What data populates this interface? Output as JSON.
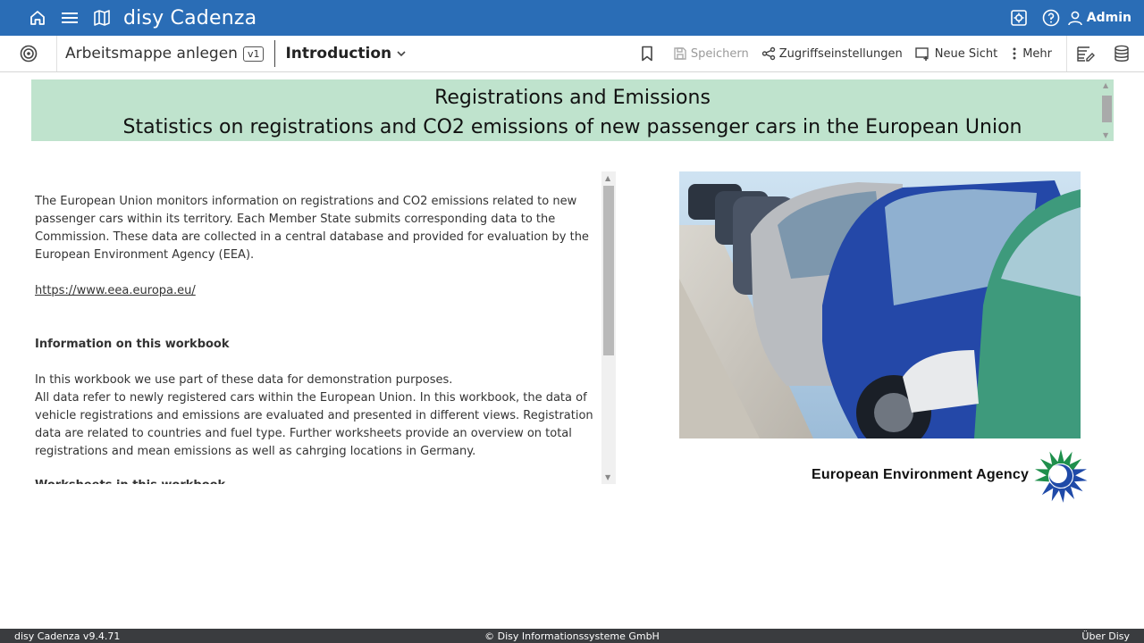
{
  "app": {
    "brand": "disy Cadenza",
    "user": "Admin"
  },
  "toolbar": {
    "workbook_name": "Arbeitsmappe anlegen",
    "version": "v1",
    "view_name": "Introduction",
    "save_label": "Speichern",
    "access_label": "Zugriffseinstellungen",
    "new_view_label": "Neue Sicht",
    "more_label": "Mehr"
  },
  "banner": {
    "title": "Registrations and Emissions",
    "subtitle": "Statistics on registrations and CO2 emissions of new passenger cars in the European Union"
  },
  "text": {
    "para1": "The European Union monitors information on registrations and CO2 emissions related to new passenger cars within its territory. Each Member State submits corresponding data to the Commission. These data are collected in a central database and provided for evaluation by the European Environment Agency (EEA).",
    "link": "https://www.eea.europa.eu/",
    "heading": "Information on this workbook",
    "para2": "In this workbook we use part of these data for demonstration purposes.",
    "para3": "All data refer to newly registered cars within the European Union. In this workbook, the data of vehicle registrations and emissions are evaluated and presented in different views. Registration data are related to countries and fuel type. Further worksheets provide an overview on total registrations and mean emissions as well as cahrging locations in Germany.",
    "cut_heading": "Worksheets in this workbook"
  },
  "logo": {
    "name": "European Environment Agency"
  },
  "footer": {
    "version": "disy Cadenza v9.4.71",
    "copyright": "© Disy Informationssysteme GmbH",
    "about": "Über Disy"
  },
  "colors": {
    "appbar": "#2a6db6",
    "banner": "#bfe3cd",
    "footer": "#3a3c3f"
  }
}
